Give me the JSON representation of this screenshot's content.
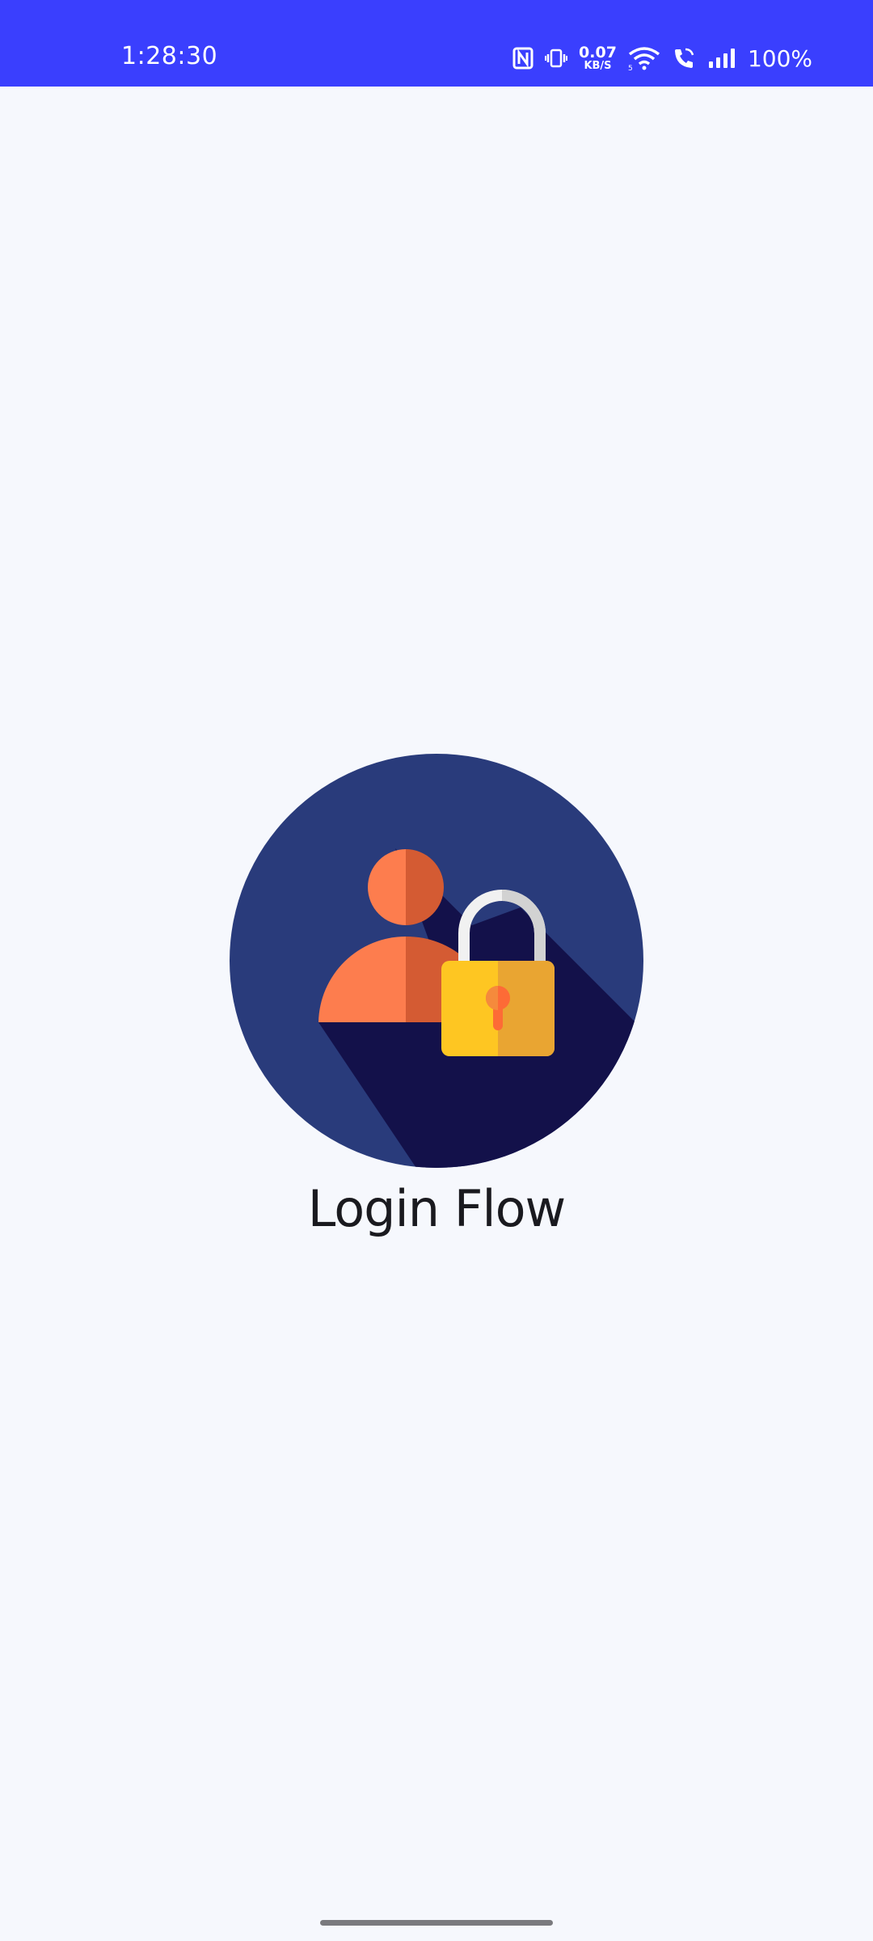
{
  "status_bar": {
    "time": "1:28:30",
    "net_speed_value": "0.07",
    "net_speed_unit": "KB/S",
    "battery": "100%",
    "background_color": "#3a3ffe",
    "icons": [
      "nfc-icon",
      "vibrate-icon",
      "wifi-icon",
      "wifi-call-icon",
      "signal-icon"
    ]
  },
  "splash": {
    "title": "Login Flow",
    "logo_icon": "user-lock-icon",
    "background_color": "#f6f8fd"
  }
}
